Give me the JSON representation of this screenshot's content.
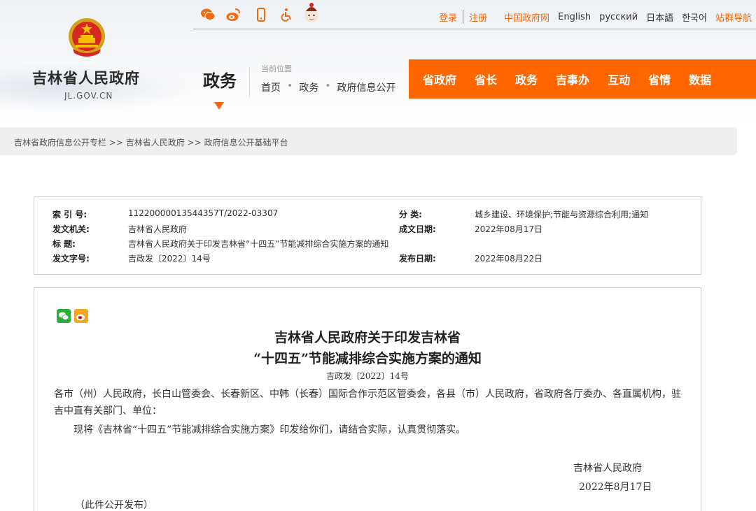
{
  "header": {
    "site_name": "吉林省人民政府",
    "site_domain": "JL.GOV.CN",
    "section_title": "政务",
    "location_label": "当前位置",
    "location_path": [
      "首页",
      "政务",
      "政府信息公开"
    ]
  },
  "topbar": {
    "icons": [
      "wechat-icon",
      "weibo-icon",
      "mobile-icon",
      "accessibility-icon",
      "mascot-icon"
    ],
    "login": "登录",
    "register": "注册",
    "links": [
      "中国政府网",
      "English",
      "русский",
      "日本語",
      "한국어",
      "站群导航"
    ]
  },
  "mainnav": {
    "items": [
      "省政府",
      "省长",
      "政务",
      "吉事办",
      "互动",
      "省情",
      "数据"
    ]
  },
  "breadcrumb": {
    "text": "吉林省政府信息公开专栏 >> 吉林省人民政府 >> 政府信息公开基础平台"
  },
  "meta": {
    "index_label": "索 引 号:",
    "index_value": "11220000013544357T/2022-03307",
    "category_label": "分    类:",
    "category_value": "城乡建设、环境保护;节能与资源综合利用;通知",
    "issuer_label": "发文机关:",
    "issuer_value": "吉林省人民政府",
    "created_label": "成文日期:",
    "created_value": "2022年08月17日",
    "title_label": "标      题:",
    "title_value": "吉林省人民政府关于印发吉林省“十四五”节能减排综合实施方案的通知",
    "docno_label": "发文字号:",
    "docno_value": "吉政发〔2022〕14号",
    "published_label": "发布日期:",
    "published_value": "2022年08月22日"
  },
  "article": {
    "title_line1": "吉林省人民政府关于印发吉林省",
    "title_line2": "“十四五”节能减排综合实施方案的通知",
    "doc_number": "吉政发〔2022〕14号",
    "recipients": "各市（州）人民政府，长白山管委会、长春新区、中韩（长春）国际合作示范区管委会，各县（市）人民政府，省政府各厅委办、各直属机构，驻吉中直有关部门、单位：",
    "paragraph": "现将《吉林省“十四五”节能减排综合实施方案》印发给你们，请结合实际，认真贯彻落实。",
    "signature": "吉林省人民政府",
    "date": "2022年8月17日",
    "note": "（此件公开发布）"
  },
  "colors": {
    "brand_orange": "#ff6600",
    "link_orange": "#f26a10"
  }
}
